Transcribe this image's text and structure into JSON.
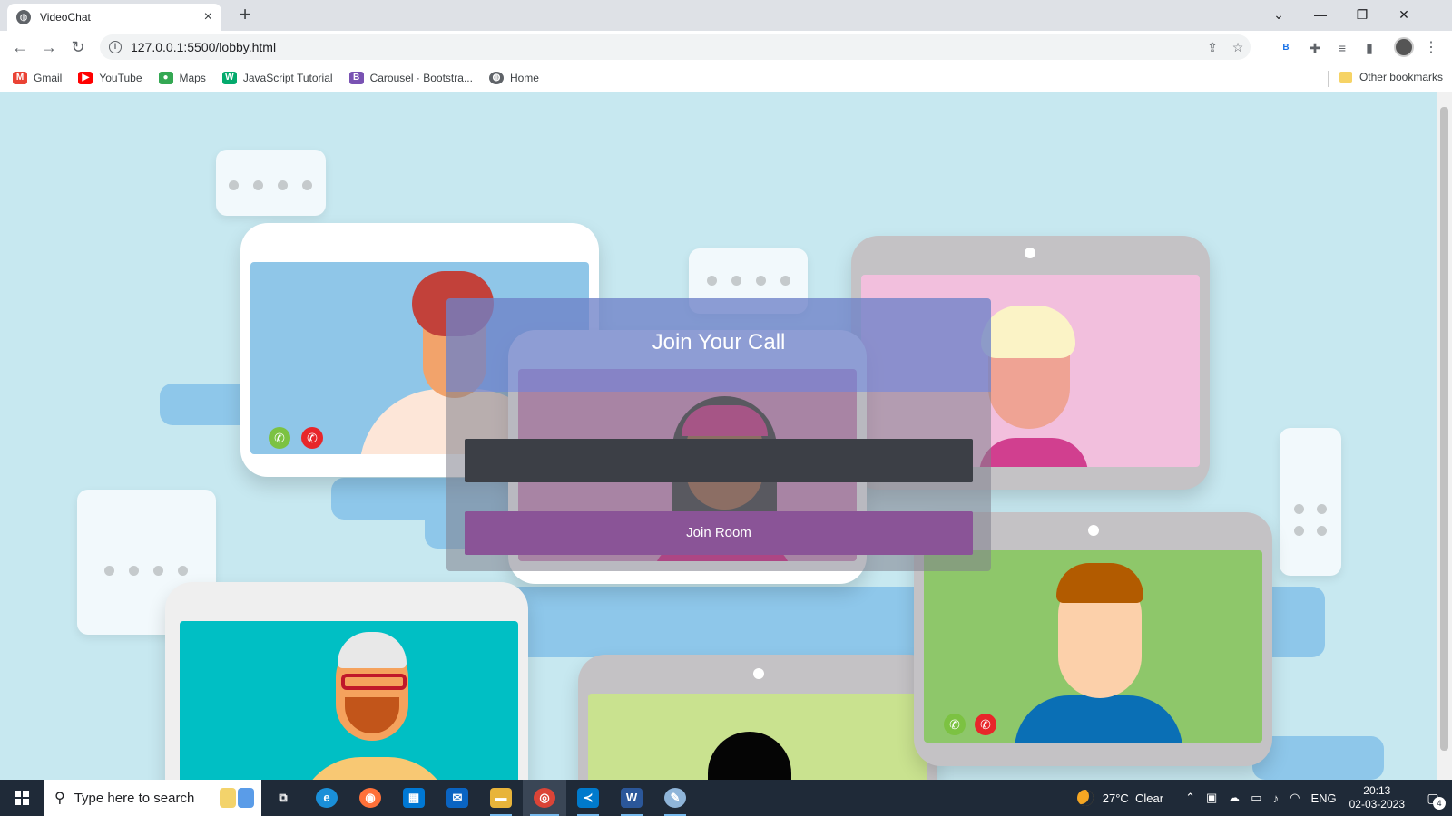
{
  "browser": {
    "tab_title": "VideoChat",
    "tab_close": "×",
    "new_tab": "+",
    "url": "127.0.0.1:5500/lobby.html",
    "window_controls": {
      "dropdown": "⌄",
      "minimize": "—",
      "restore": "❐",
      "close": "✕"
    },
    "nav": {
      "back": "←",
      "forward": "→",
      "reload": "↻"
    },
    "extension_b": "B",
    "menu": "⋮"
  },
  "bookmarks": [
    {
      "label": "Gmail",
      "icon": "gmail-icon",
      "glyph": "M",
      "color": "#ea4335"
    },
    {
      "label": "YouTube",
      "icon": "youtube-icon",
      "glyph": "▶",
      "color": "#ff0000"
    },
    {
      "label": "Maps",
      "icon": "maps-icon",
      "glyph": "●",
      "color": "#34a853"
    },
    {
      "label": "JavaScript Tutorial",
      "icon": "w3schools-icon",
      "glyph": "W",
      "color": "#04aa6d"
    },
    {
      "label": "Carousel · Bootstra...",
      "icon": "bootstrap-icon",
      "glyph": "B",
      "color": "#7952b3"
    },
    {
      "label": "Home",
      "icon": "globe-icon",
      "glyph": "◍",
      "color": "#5f6368"
    }
  ],
  "other_bookmarks": "Other bookmarks",
  "lobby": {
    "title": "Join Your Call",
    "room_input_value": "",
    "join_button": "Join Room"
  },
  "taskbar": {
    "search_placeholder": "Type here to search",
    "apps": [
      {
        "name": "task-view-icon",
        "glyph": "⧉",
        "color": "#1f2a38"
      },
      {
        "name": "edge-icon",
        "glyph": "e",
        "color": "#1a8fd8"
      },
      {
        "name": "firefox-icon",
        "glyph": "◉",
        "color": "#ff7139"
      },
      {
        "name": "store-icon",
        "glyph": "▦",
        "color": "#0078d4"
      },
      {
        "name": "mail-icon",
        "glyph": "✉",
        "color": "#0a64c2"
      },
      {
        "name": "file-explorer-icon",
        "glyph": "▬",
        "color": "#e8b43a"
      },
      {
        "name": "chrome-icon",
        "glyph": "◎",
        "color": "#db4437"
      },
      {
        "name": "vscode-icon",
        "glyph": "≺",
        "color": "#007acc"
      },
      {
        "name": "word-icon",
        "glyph": "W",
        "color": "#2b579a"
      },
      {
        "name": "paint-icon",
        "glyph": "✎",
        "color": "#8fb5d9"
      }
    ],
    "weather": "27°C  Clear",
    "language": "ENG",
    "time": "20:13",
    "date": "02-03-2023",
    "notifications": "4"
  },
  "colors": {
    "page_bg": "#c7e8f0",
    "join_button": "#8a5497",
    "overlay_header": "#6e82c8",
    "input_bg": "#3c3f46"
  }
}
